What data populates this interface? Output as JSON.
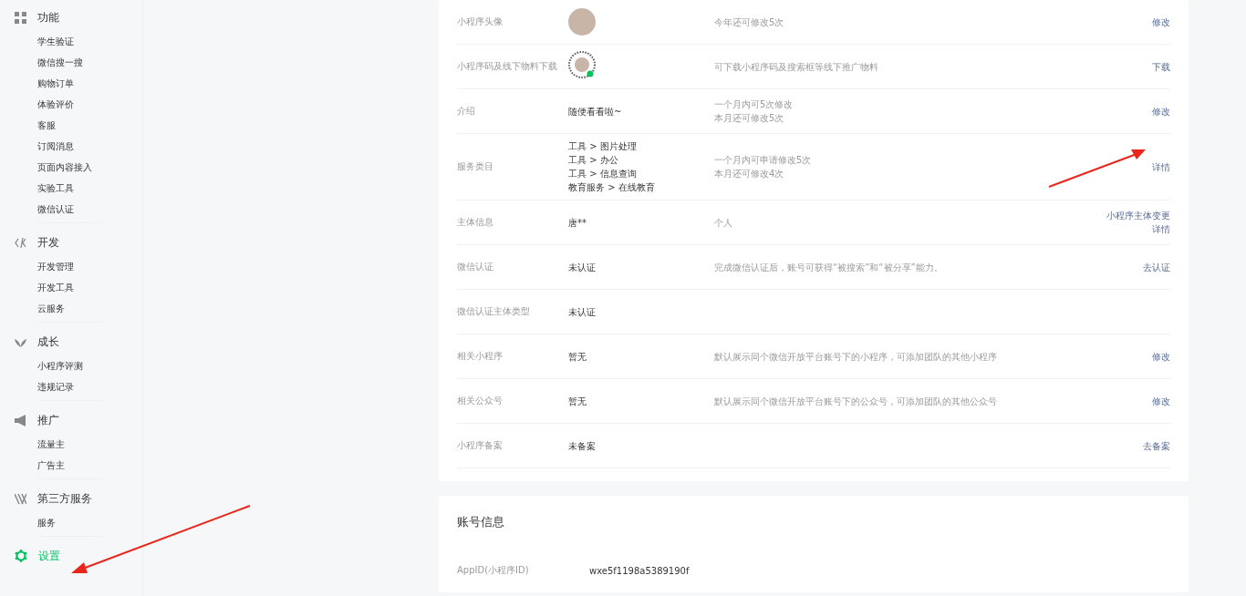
{
  "sidebar": {
    "sections": [
      {
        "kind": "grid",
        "title": "功能",
        "items": [
          "学生验证",
          "微信搜一搜",
          "购物订单",
          "体验评价",
          "客服",
          "订阅消息",
          "页面内容接入",
          "实验工具",
          "微信认证"
        ]
      },
      {
        "kind": "code",
        "title": "开发",
        "items": [
          "开发管理",
          "开发工具",
          "云服务"
        ]
      },
      {
        "kind": "sprout",
        "title": "成长",
        "items": [
          "小程序评测",
          "违规记录"
        ]
      },
      {
        "kind": "megaphone",
        "title": "推广",
        "items": [
          "流量主",
          "广告主"
        ]
      },
      {
        "kind": "third",
        "title": "第三方服务",
        "items": [
          "服务"
        ]
      }
    ],
    "settings": {
      "label": "设置",
      "selected": true
    }
  },
  "basic_info": {
    "rows": [
      {
        "label": "小程序头像",
        "kind": "avatar",
        "notes": [
          "今年还可修改5次"
        ],
        "actions": [
          "修改"
        ]
      },
      {
        "label": "小程序码及线下物料下载",
        "kind": "qrcode",
        "notes": [
          "可下载小程序码及搜索框等线下推广物料"
        ],
        "actions": [
          "下载"
        ]
      },
      {
        "label": "介绍",
        "kind": "text",
        "values": [
          "随便看看啦~"
        ],
        "notes": [
          "一个月内可5次修改",
          "本月还可修改5次"
        ],
        "actions": [
          "修改"
        ]
      },
      {
        "label": "服务类目",
        "kind": "text",
        "values": [
          "工具 > 图片处理",
          "工具 > 办公",
          "工具 > 信息查询",
          "教育服务 > 在线教育"
        ],
        "notes": [
          "一个月内可申请修改5次",
          "本月还可修改4次"
        ],
        "actions": [
          "详情"
        ]
      },
      {
        "label": "主体信息",
        "kind": "text",
        "values": [
          "唐**"
        ],
        "notes": [
          "个人"
        ],
        "actions": [
          "小程序主体变更",
          "详情"
        ]
      },
      {
        "label": "微信认证",
        "kind": "text",
        "values": [
          "未认证"
        ],
        "notes": [
          "完成微信认证后，账号可获得“被搜索”和“被分享”能力。"
        ],
        "actions": [
          "去认证"
        ]
      },
      {
        "label": "微信认证主体类型",
        "kind": "text",
        "values": [
          "未认证"
        ]
      },
      {
        "label": "相关小程序",
        "kind": "text",
        "values": [
          "暂无"
        ],
        "notes": [
          "默认展示同个微信开放平台账号下的小程序，可添加团队的其他小程序"
        ],
        "actions": [
          "修改"
        ]
      },
      {
        "label": "相关公众号",
        "kind": "text",
        "values": [
          "暂无"
        ],
        "notes": [
          "默认展示同个微信开放平台账号下的公众号，可添加团队的其他公众号"
        ],
        "actions": [
          "修改"
        ]
      },
      {
        "label": "小程序备案",
        "kind": "text",
        "values": [
          "未备案"
        ],
        "actions": [
          "去备案"
        ]
      }
    ]
  },
  "account_info": {
    "title": "账号信息",
    "rows": [
      {
        "label": "AppID(小程序ID)",
        "value": "wxe5f1198a5389190f"
      }
    ]
  }
}
